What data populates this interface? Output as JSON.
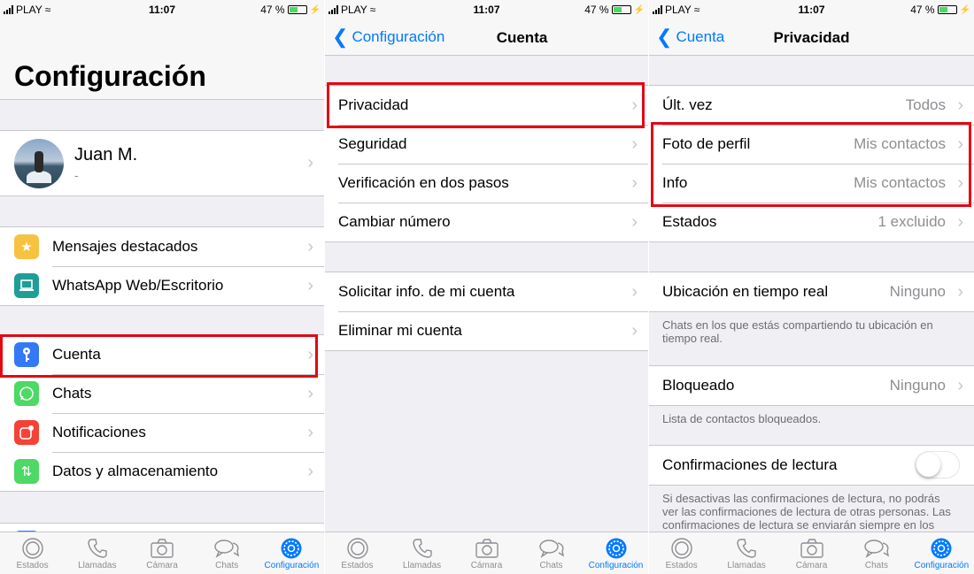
{
  "status_bar": {
    "carrier": "PLAY",
    "time": "11:07",
    "battery": "47 %"
  },
  "panel1": {
    "title": "Configuración",
    "profile": {
      "name": "Juan M.",
      "status": "-"
    },
    "group1": [
      {
        "label": "Mensajes destacados",
        "icon": "star-icon",
        "color": "#f6c341"
      },
      {
        "label": "WhatsApp Web/Escritorio",
        "icon": "laptop-icon",
        "color": "#1f9e97"
      }
    ],
    "group2": [
      {
        "label": "Cuenta",
        "icon": "key-icon",
        "color": "#3478f6"
      },
      {
        "label": "Chats",
        "icon": "whatsapp-icon",
        "color": "#4cd964"
      },
      {
        "label": "Notificaciones",
        "icon": "notification-icon",
        "color": "#f44336"
      },
      {
        "label": "Datos y almacenamiento",
        "icon": "data-arrows-icon",
        "color": "#4cd964"
      }
    ]
  },
  "panel2": {
    "back": "Configuración",
    "title": "Cuenta",
    "group1": [
      "Privacidad",
      "Seguridad",
      "Verificación en dos pasos",
      "Cambiar número"
    ],
    "group2": [
      "Solicitar info. de mi cuenta",
      "Eliminar mi cuenta"
    ]
  },
  "panel3": {
    "back": "Cuenta",
    "title": "Privacidad",
    "group1": [
      {
        "label": "Últ. vez",
        "value": "Todos"
      },
      {
        "label": "Foto de perfil",
        "value": "Mis contactos"
      },
      {
        "label": "Info",
        "value": "Mis contactos"
      },
      {
        "label": "Estados",
        "value": "1 excluido"
      }
    ],
    "location": {
      "label": "Ubicación en tiempo real",
      "value": "Ninguno",
      "note": "Chats en los que estás compartiendo tu ubicación en tiempo real."
    },
    "blocked": {
      "label": "Bloqueado",
      "value": "Ninguno",
      "note": "Lista de contactos bloqueados."
    },
    "read_receipts": {
      "label": "Confirmaciones de lectura",
      "enabled": false,
      "note": "Si desactivas las confirmaciones de lectura, no podrás ver las confirmaciones de lectura de otras personas. Las confirmaciones de lectura se enviarán siempre en los"
    }
  },
  "tabs": [
    {
      "label": "Estados",
      "icon": "status-icon"
    },
    {
      "label": "Llamadas",
      "icon": "phone-icon"
    },
    {
      "label": "Cámara",
      "icon": "camera-icon"
    },
    {
      "label": "Chats",
      "icon": "chat-bubbles-icon"
    },
    {
      "label": "Configuración",
      "icon": "settings-gear-icon",
      "active": true
    }
  ],
  "colors": {
    "accent": "#007aff",
    "highlight": "#e30613"
  }
}
